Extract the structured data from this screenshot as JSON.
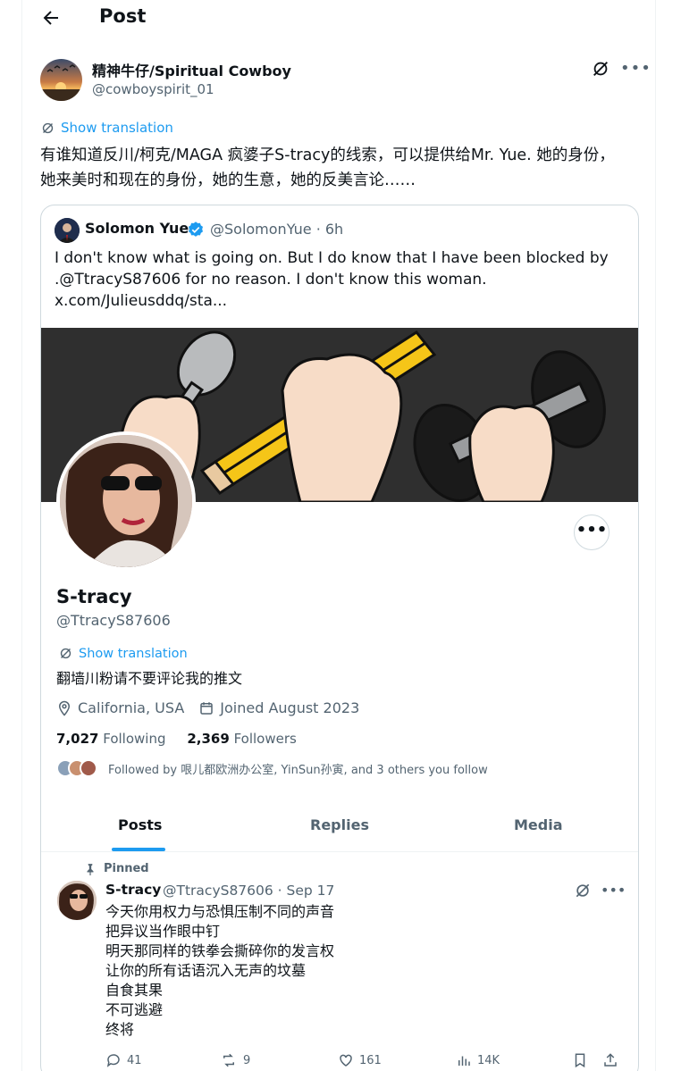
{
  "header": {
    "title": "Post"
  },
  "post": {
    "author_name": "精神牛仔/Spiritual Cowboy",
    "author_handle": "@cowboyspirit_01",
    "translate_label": "Show translation",
    "text": "有谁知道反川/柯克/MAGA 疯婆子S-tracy的线索，可以提供给Mr. Yue. 她的身份，她来美时和现在的身份，她的生意，她的反美言论……"
  },
  "quote": {
    "name": "Solomon Yue",
    "meta": "@SolomonYue · 6h",
    "lines": [
      "I don't know what is going on. But I do know that I have been blocked by",
      ".@TtracyS87606 for no reason. I don't know this woman.",
      "x.com/Julieusddq/sta..."
    ],
    "profile": {
      "name": "S-tracy",
      "handle": "@TtracyS87606",
      "translate_label": "Show translation",
      "bio": "翻墙川粉请不要评论我的推文",
      "location": "California, USA",
      "joined": "Joined August 2023",
      "following_count": "7,027",
      "following_label": "Following",
      "followers_count": "2,369",
      "followers_label": "Followers",
      "followed_by": "Followed by 哏儿都欧洲办公室, YinSun孙寅, and 3 others you follow"
    },
    "tabs": [
      "Posts",
      "Replies",
      "Media"
    ],
    "pinned_tweet": {
      "pinned_label": "Pinned",
      "name": "S-tracy",
      "meta": "@TtracyS87606 · Sep 17",
      "lines": [
        "今天你用权力与恐惧压制不同的声音",
        "把异议当作眼中钉",
        "明天那同样的铁拳会撕碎你的发言权",
        "让你的所有话语沉入无声的坟墓",
        "自食其果",
        "不可逃避",
        "终将"
      ],
      "replies": "41",
      "reposts": "9",
      "likes": "161",
      "views": "14K"
    }
  },
  "colors": {
    "accent": "#1d9bf0",
    "text": "#0f1419",
    "muted": "#536471",
    "border": "#cfd9de"
  },
  "icons": [
    "back-arrow-icon",
    "grok-icon",
    "more-icon",
    "translate-icon",
    "verified-icon",
    "location-icon",
    "calendar-icon",
    "pin-icon",
    "reply-icon",
    "repost-icon",
    "like-icon",
    "views-icon",
    "bookmark-icon",
    "share-icon"
  ]
}
